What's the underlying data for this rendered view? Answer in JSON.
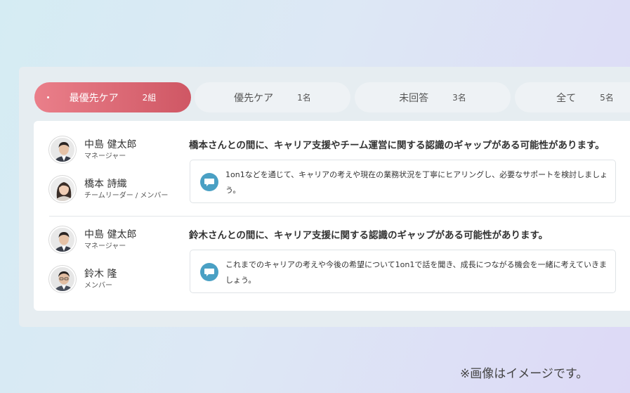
{
  "tabs": [
    {
      "label": "最優先ケア",
      "count": "2組",
      "active": true
    },
    {
      "label": "優先ケア",
      "count": "1名",
      "active": false
    },
    {
      "label": "未回答",
      "count": "3名",
      "active": false
    },
    {
      "label": "全て",
      "count": "5名",
      "active": false
    }
  ],
  "pairs": [
    {
      "people": [
        {
          "name": "中島 健太郎",
          "role": "マネージャー"
        },
        {
          "name": "橋本 詩織",
          "role": "チームリーダー / メンバー"
        }
      ],
      "headline": "橋本さんとの間に、キャリア支援やチーム運営に関する認識のギャップがある可能性があります。",
      "advice": "1on1などを通じて、キャリアの考えや現在の業務状況を丁寧にヒアリングし、必要なサポートを検討しましょう。"
    },
    {
      "people": [
        {
          "name": "中島 健太郎",
          "role": "マネージャー"
        },
        {
          "name": "鈴木 隆",
          "role": "メンバー"
        }
      ],
      "headline": "鈴木さんとの間に、キャリア支援に関する認識のギャップがある可能性があります。",
      "advice": "これまでのキャリアの考えや今後の希望について1on1で話を聞き、成長につながる機会を一緒に考えていきましょう。"
    }
  ],
  "disclaimer": "※画像はイメージです。",
  "icons": {
    "advice": "chat-bubble-icon",
    "avatar": "person-photo-icon"
  },
  "colors": {
    "accent_start": "#ea7f8a",
    "accent_end": "#cf5764",
    "bubble": "#4aa0c4"
  }
}
